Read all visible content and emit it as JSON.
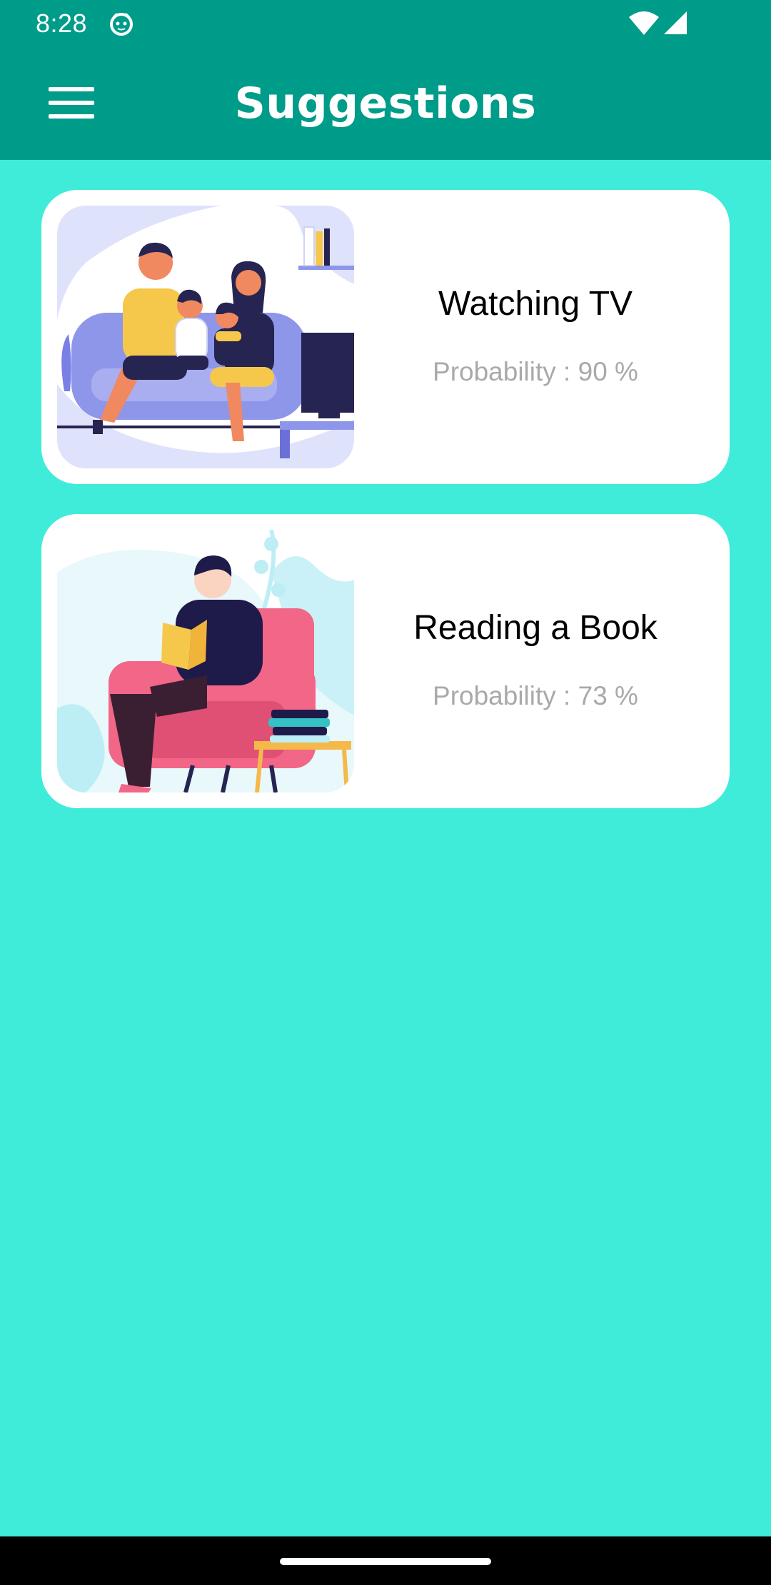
{
  "status_bar": {
    "time": "8:28",
    "icons": [
      "app-notification-icon",
      "wifi-icon",
      "cell-signal-icon"
    ]
  },
  "app_bar": {
    "title": "Suggestions",
    "menu_icon": "hamburger-menu-icon",
    "background_color": "#009c8a"
  },
  "suggestions": [
    {
      "title": "Watching TV",
      "probability_text": "Probability : 90 %",
      "probability": 90,
      "illustration": "family-watching-tv-illustration"
    },
    {
      "title": "Reading a Book",
      "probability_text": "Probability : 73 %",
      "probability": 73,
      "illustration": "person-reading-book-illustration"
    }
  ],
  "colors": {
    "background": "#3eecd9",
    "card": "#ffffff",
    "title_text": "#000000",
    "probability_text": "#a9a9a9"
  }
}
